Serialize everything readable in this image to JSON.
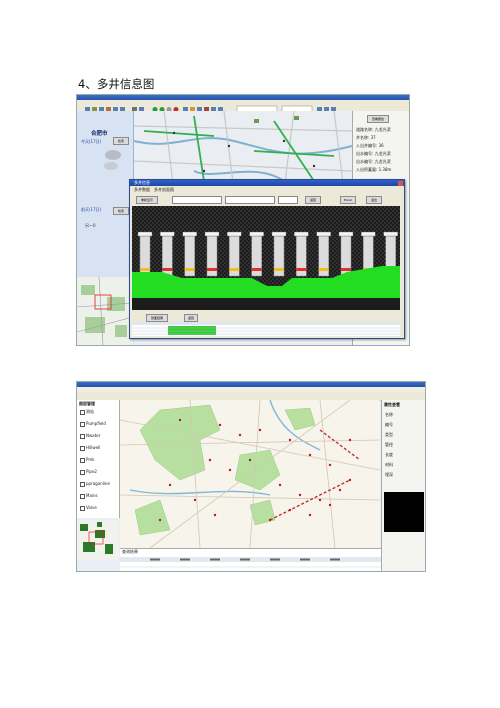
{
  "heading": "4、多井信息图",
  "screenshot1": {
    "city_label": "合肥市",
    "left_panel_labels": [
      "今天(17日)",
      "前天(17日)",
      "另一0"
    ],
    "panel_buttons": [
      "检索",
      "检索",
      "结论点系统",
      "结论系统"
    ],
    "info_panel_tab": "查看属性",
    "info_panel_lines": [
      "道路名称: 九龙光滨",
      "井名称: 37",
      "入出井编号: 36",
      "出水编号: 九龙光滨",
      "出水编号: 九龙光滨",
      "入出积蓄量: 1.38m"
    ],
    "dialog": {
      "title": "多井信息",
      "tabs": [
        "多井数据",
        "多井剖面图"
      ],
      "buttons": [
        "重新显示",
        "返回",
        "Excel",
        "退出"
      ],
      "bottom_buttons": [
        "剖面结果",
        "返回"
      ],
      "well_count": 12
    }
  },
  "screenshot2": {
    "layer_panel_title": "图层管理",
    "layer_items": [
      "测站",
      "Pumpfield",
      "Nwater",
      "Hillwell",
      "Pmk",
      "Pipe2",
      "ppraganline",
      "Mains",
      "Valve"
    ],
    "right_panel_title": "属性查看",
    "right_panel_rows": [
      "名称",
      "编号",
      "类型",
      "管径",
      "长度",
      "材料",
      "埋深"
    ],
    "right_panel_bottom_title": "视频播放",
    "bottom_panel_title": "查询结果"
  }
}
